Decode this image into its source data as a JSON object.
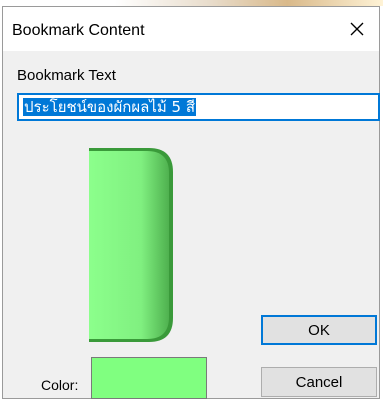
{
  "dialog": {
    "title": "Bookmark Content",
    "close_icon": "close-icon"
  },
  "bookmark_text": {
    "label": "Bookmark Text",
    "value": "ประโยชน์ของผักผลไม้ 5 สี"
  },
  "preview": {
    "shape": "bookmark-tab",
    "fill_color": "#80ff80",
    "edge_color": "#3a9a3a"
  },
  "color": {
    "label": "Color:",
    "value": "#80ff80"
  },
  "buttons": {
    "ok_label": "OK",
    "cancel_label": "Cancel"
  },
  "colors": {
    "accent": "#0078d7",
    "dialog_bg": "#f0f0f0"
  }
}
